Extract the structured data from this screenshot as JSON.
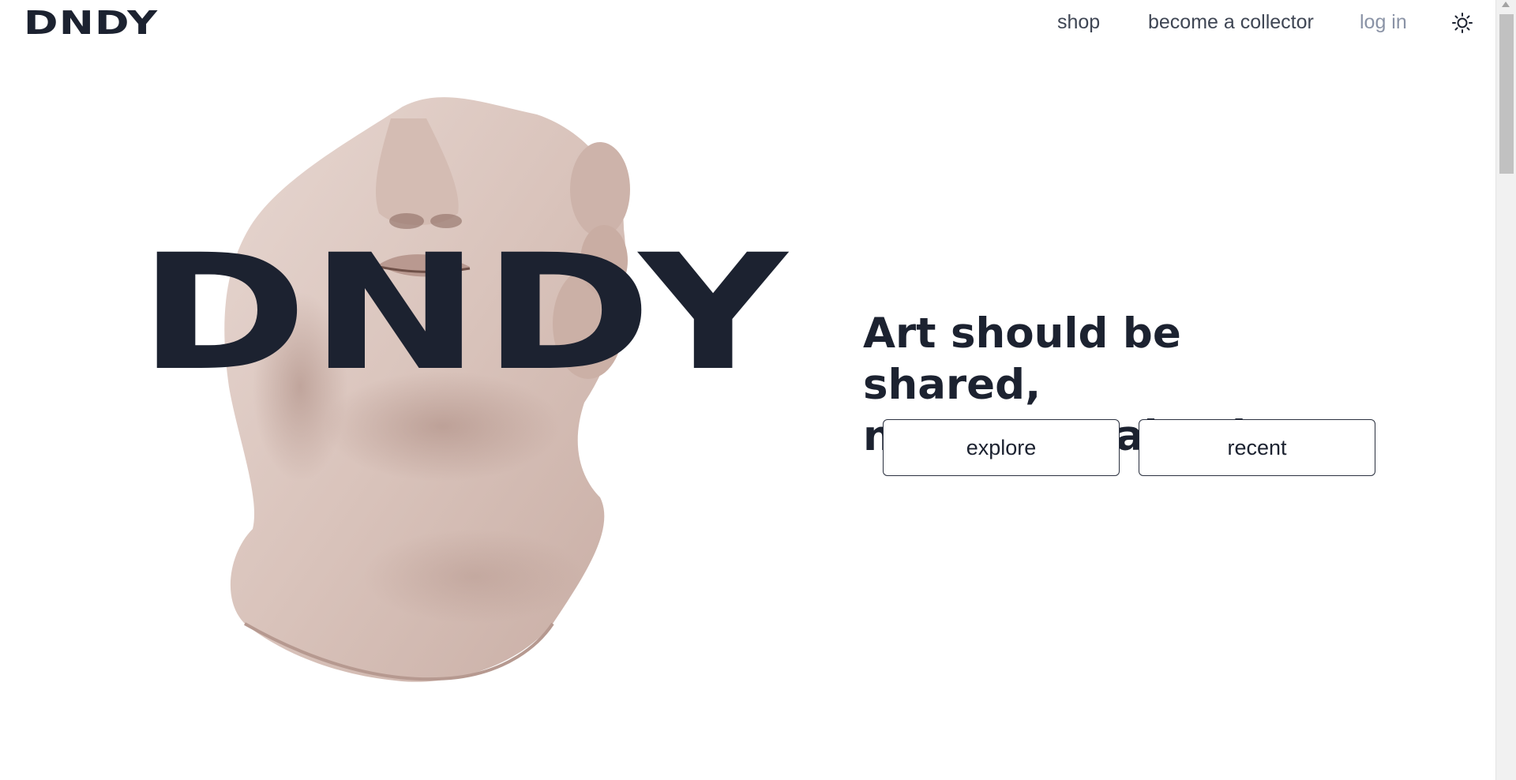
{
  "header": {
    "logo": "DNDY",
    "nav": {
      "shop": "shop",
      "become_collector": "become a collector",
      "login": "log in"
    },
    "theme_icon": "sun-icon"
  },
  "hero": {
    "image": "statue-head",
    "brand_word": "DNDY",
    "tagline_line1": "Art should be shared,",
    "tagline_line2": "never contained.",
    "buttons": {
      "explore": "explore",
      "recent": "recent"
    }
  },
  "colors": {
    "text": "#1c2230",
    "nav": "#3f4654",
    "login": "#8a93a6",
    "statue": "#e0cfc8",
    "background": "#ffffff"
  }
}
